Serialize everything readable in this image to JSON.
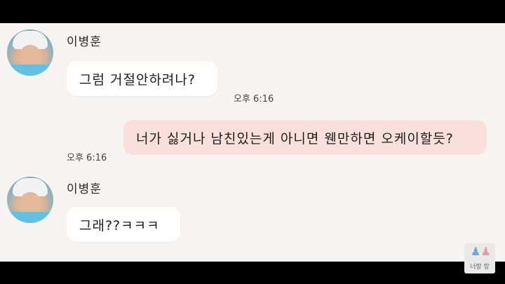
{
  "messages": [
    {
      "sender": "이병훈",
      "text": "그럼 거절안하려나?",
      "time": "오후 6:16"
    },
    {
      "text": "너가 싫거나 남친있는게 아니면 웬만하면 오케이할듯?",
      "time": "오후 6:16"
    },
    {
      "sender": "이병훈",
      "text": "그래??ㅋㅋㅋ"
    }
  ],
  "watermark": {
    "text": "너랑 랑"
  },
  "colors": {
    "background": "#f7f3f0",
    "incoming_bubble": "#ffffff",
    "outgoing_bubble": "#fae0dc"
  }
}
